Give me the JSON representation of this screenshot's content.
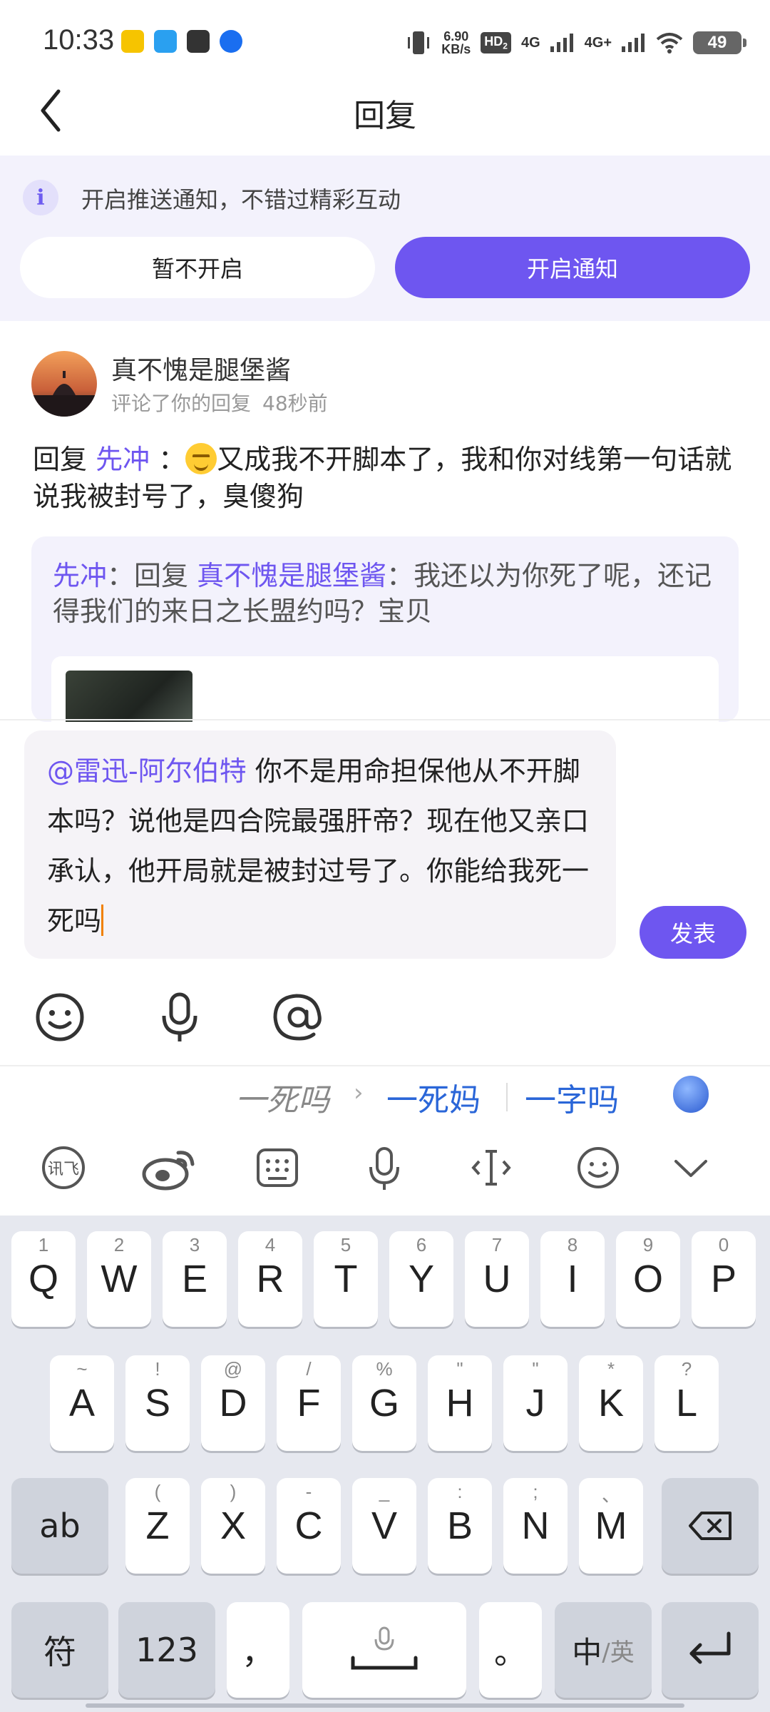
{
  "status_bar": {
    "time": "10:33",
    "speed_value": "6.90",
    "speed_unit": "KB/s",
    "hd_label": "HD",
    "hd_sub": "2",
    "net1": "4G",
    "net2": "4G+",
    "battery": "49"
  },
  "header": {
    "title": "回复"
  },
  "notification": {
    "text": "开启推送通知，不错过精彩互动",
    "later_button": "暂不开启",
    "enable_button": "开启通知"
  },
  "comment": {
    "username": "真不愧是腿堡酱",
    "action": "评论了你的回复",
    "time_ago": "48秒前",
    "reply_prefix": "回复",
    "reply_to": "先冲",
    "colon": "：",
    "text": "又成我不开脚本了，我和你对线第一句话就说我被封号了，臭傻狗"
  },
  "quote": {
    "author": "先冲",
    "sep": "：回复",
    "mention": "真不愧是腿堡酱",
    "text": "：我还以为你死了呢，还记得我们的来日之长盟约吗？宝贝"
  },
  "compose": {
    "mention": "@雷迅-阿尔伯特",
    "text": " 你不是用命担保他从不开脚本吗？说他是四合院最强肝帝？现在他又亲口承认，他开局就是被封过号了。你能给我死一死吗",
    "post_button": "发表"
  },
  "candidates": {
    "raw": "一死吗",
    "arrow": "›",
    "items": [
      "一死妈",
      "一字吗"
    ]
  },
  "keyboard": {
    "row1": [
      {
        "hint": "1",
        "key": "Q"
      },
      {
        "hint": "2",
        "key": "W"
      },
      {
        "hint": "3",
        "key": "E"
      },
      {
        "hint": "4",
        "key": "R"
      },
      {
        "hint": "5",
        "key": "T"
      },
      {
        "hint": "6",
        "key": "Y"
      },
      {
        "hint": "7",
        "key": "U"
      },
      {
        "hint": "8",
        "key": "I"
      },
      {
        "hint": "9",
        "key": "O"
      },
      {
        "hint": "0",
        "key": "P"
      }
    ],
    "row2": [
      {
        "hint": "~",
        "key": "A"
      },
      {
        "hint": "!",
        "key": "S"
      },
      {
        "hint": "@",
        "key": "D"
      },
      {
        "hint": "/",
        "key": "F"
      },
      {
        "hint": "%",
        "key": "G"
      },
      {
        "hint": "\"",
        "key": "H"
      },
      {
        "hint": "\"",
        "key": "J"
      },
      {
        "hint": "*",
        "key": "K"
      },
      {
        "hint": "?",
        "key": "L"
      }
    ],
    "row3": [
      {
        "hint": "(",
        "key": "Z"
      },
      {
        "hint": ")",
        "key": "X"
      },
      {
        "hint": "-",
        "key": "C"
      },
      {
        "hint": "_",
        "key": "V"
      },
      {
        "hint": ":",
        "key": "B"
      },
      {
        "hint": ";",
        "key": "N"
      },
      {
        "hint": "、",
        "key": "M"
      }
    ],
    "shift_label": "ab",
    "symbol_label": "符",
    "number_label": "123",
    "comma_label": "，",
    "period_label": "。",
    "lang_main": "中",
    "lang_sub": "/英"
  }
}
